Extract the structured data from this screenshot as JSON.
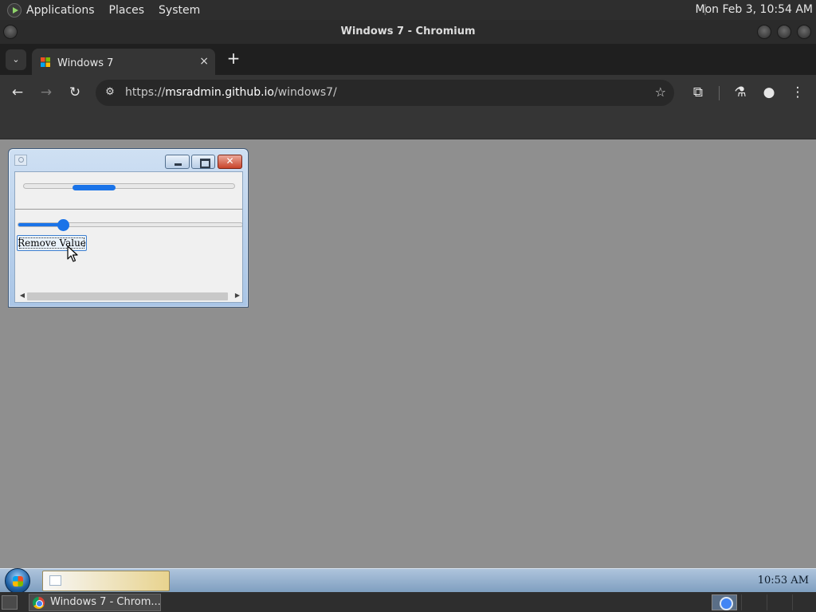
{
  "top_panel": {
    "menus": [
      "Applications",
      "Places",
      "System"
    ],
    "clock": "Mon Feb  3, 10:54 AM"
  },
  "window": {
    "title": "Windows 7 - Chromium"
  },
  "browser": {
    "tab_title": "Windows 7",
    "tab_close": "×",
    "new_tab": "+",
    "tab_menu": "⌄",
    "url_scheme": "https://",
    "url_host": "msradmin.github.io",
    "url_path": "/windows7/",
    "icons": {
      "back": "←",
      "forward": "→",
      "reload": "↻",
      "site_info": "⚙",
      "star": "☆",
      "extensions": "⧉",
      "labs": "⚗",
      "profile": "●",
      "menu": "⋮"
    }
  },
  "win7_window": {
    "close_glyph": "✕",
    "progress_value": 0.2,
    "slider_value": 0.2,
    "button_label": "Remove Value",
    "scroll_left": "◀",
    "scroll_right": "▶"
  },
  "win7_taskbar": {
    "clock": "10:53 AM"
  },
  "bottom_panel": {
    "task_label": "Windows 7 - Chrom..."
  },
  "colors": {
    "accent": "#1a73e8",
    "desktop": "#8f8f8f"
  }
}
